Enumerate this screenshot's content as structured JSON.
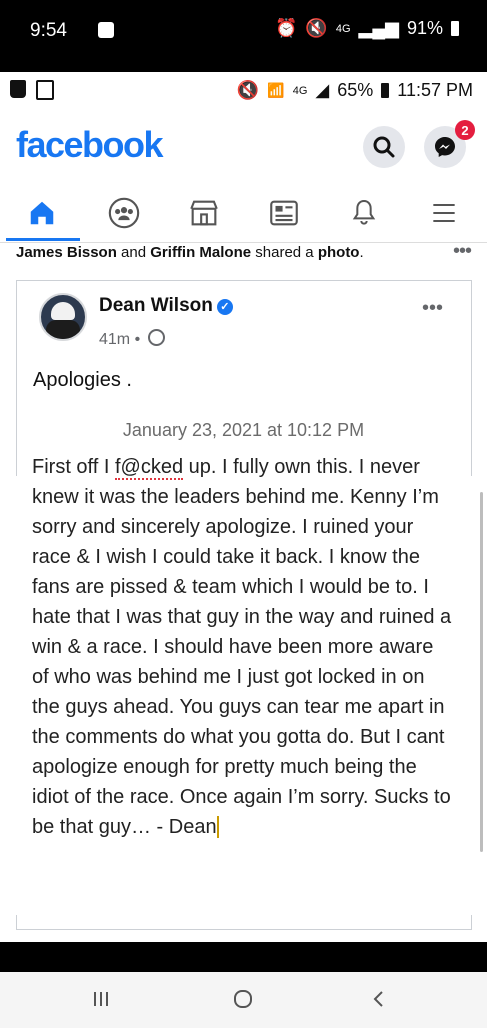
{
  "outer_status": {
    "time": "9:54",
    "network": "4G",
    "battery": "91%"
  },
  "inner_status": {
    "network": "4G",
    "battery": "65%",
    "time": "11:57 PM"
  },
  "header": {
    "logo": "facebook",
    "messenger_badge": "2"
  },
  "tabs": [
    {
      "name": "home",
      "icon": "home-icon",
      "active": true
    },
    {
      "name": "groups",
      "icon": "groups-icon"
    },
    {
      "name": "marketplace",
      "icon": "marketplace-icon"
    },
    {
      "name": "news",
      "icon": "news-icon"
    },
    {
      "name": "notifications",
      "icon": "bell-icon"
    },
    {
      "name": "menu",
      "icon": "menu-icon"
    }
  ],
  "shared": {
    "user1": "James Bisson",
    "conj": " and ",
    "user2": "Griffin Malone",
    "suffix": " shared a ",
    "object": "photo",
    "end": "."
  },
  "post": {
    "author": "Dean Wilson",
    "time": "41m",
    "caption": "Apologies ."
  },
  "note": {
    "date": "January 23, 2021 at 10:12 PM",
    "pre": "First off I ",
    "flagged": "f@cked",
    "body": " up. I fully own this. I never knew it was the leaders behind me. Kenny I’m sorry and sincerely apologize. I ruined your race & I wish I could take it back. I know the fans are pissed & team which I would be to. I hate that I was that guy in the way and ruined a win & a race. I should have been more aware of who was behind me I just got locked in on the guys ahead. You guys can tear me apart in the comments do what you gotta do. But I cant apologize enough for pretty much being the idiot of the race. Once again I’m sorry. Sucks to be that guy… - ",
    "end": "Dean"
  },
  "colors": {
    "brand": "#1877f2",
    "badge": "#e41e3f"
  }
}
